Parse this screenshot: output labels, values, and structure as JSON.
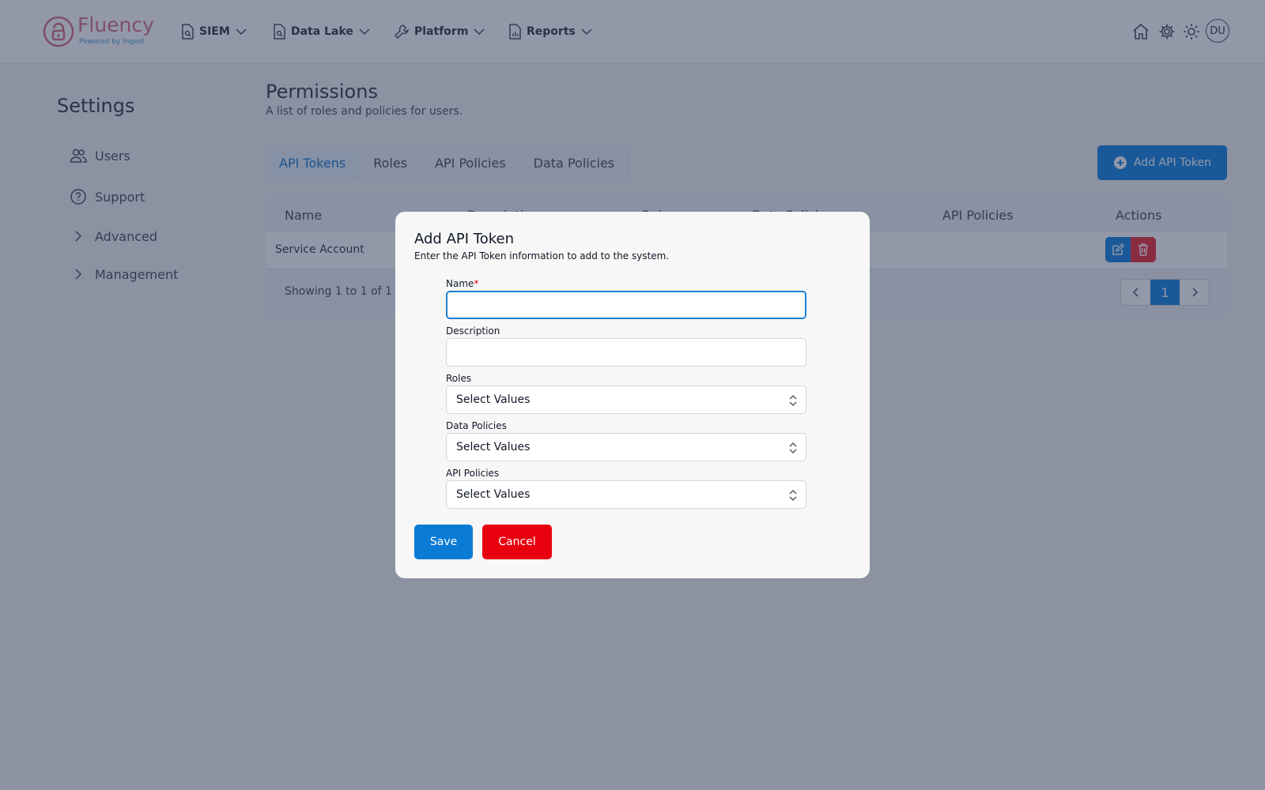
{
  "brand": {
    "name": "Fluency",
    "tagline": "Powered by Ingest"
  },
  "nav": {
    "items": [
      {
        "label": "SIEM",
        "icon": "search-document-icon"
      },
      {
        "label": "Data Lake",
        "icon": "search-document-icon"
      },
      {
        "label": "Platform",
        "icon": "wrench-icon"
      },
      {
        "label": "Reports",
        "icon": "report-document-icon"
      }
    ],
    "avatar": "DU"
  },
  "sidebar": {
    "title": "Settings",
    "items": [
      {
        "label": "Users",
        "icon": "users-icon"
      },
      {
        "label": "Support",
        "icon": "help-circle-icon"
      },
      {
        "label": "Advanced",
        "icon": "chevron-right-icon"
      },
      {
        "label": "Management",
        "icon": "chevron-right-icon"
      }
    ]
  },
  "page": {
    "title": "Permissions",
    "subtitle": "A list of roles and policies for users.",
    "tabs": [
      "API Tokens",
      "Roles",
      "API Policies",
      "Data Policies"
    ],
    "add_button": "Add API Token"
  },
  "table": {
    "columns": [
      "Name",
      "Description",
      "Roles",
      "Data Policies",
      "API Policies",
      "Actions"
    ],
    "rows": [
      {
        "name": "Service Account"
      }
    ],
    "footer": "Showing 1 to 1 of 1",
    "current_page": "1"
  },
  "modal": {
    "title": "Add API Token",
    "subtitle": "Enter the API Token information to add to the system.",
    "fields": {
      "name": {
        "label": "Name",
        "required_mark": "*",
        "value": ""
      },
      "description": {
        "label": "Description",
        "value": ""
      },
      "roles": {
        "label": "Roles",
        "value": "Select Values"
      },
      "data_policies": {
        "label": "Data Policies",
        "value": "Select Values"
      },
      "api_policies": {
        "label": "API Policies",
        "value": "Select Values"
      }
    },
    "save": "Save",
    "cancel": "Cancel"
  },
  "colors": {
    "primary": "#1e88e5",
    "danger": "#e8000f",
    "brand": "#d97486",
    "overlay": "#18254478"
  }
}
